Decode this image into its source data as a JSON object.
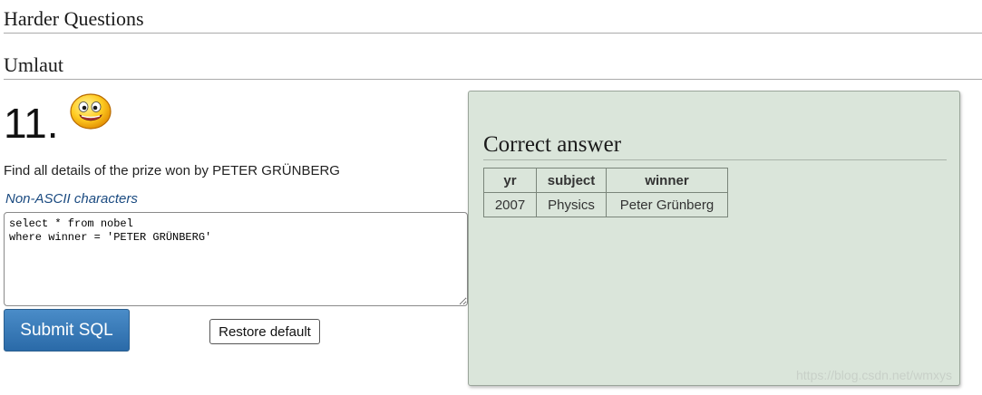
{
  "headings": {
    "section1": "Harder Questions",
    "section2": "Umlaut"
  },
  "question": {
    "number": "11.",
    "icon": "smiley-face-icon",
    "text": "Find all details of the prize won by PETER GRÜNBERG",
    "hint_link": "Non-ASCII characters",
    "sql": "select * from nobel\nwhere winner = 'PETER GRÜNBERG'"
  },
  "buttons": {
    "submit_label": "Submit SQL",
    "restore_label": "Restore default"
  },
  "answer": {
    "title": "Correct answer",
    "columns": [
      "yr",
      "subject",
      "winner"
    ],
    "rows": [
      [
        "2007",
        "Physics",
        "Peter Grünberg"
      ]
    ]
  },
  "watermark": "https://blog.csdn.net/wmxys",
  "colors": {
    "panel_bg": "#dae5da",
    "submit_bg": "#2a6aa8",
    "link": "#1a4a80"
  }
}
